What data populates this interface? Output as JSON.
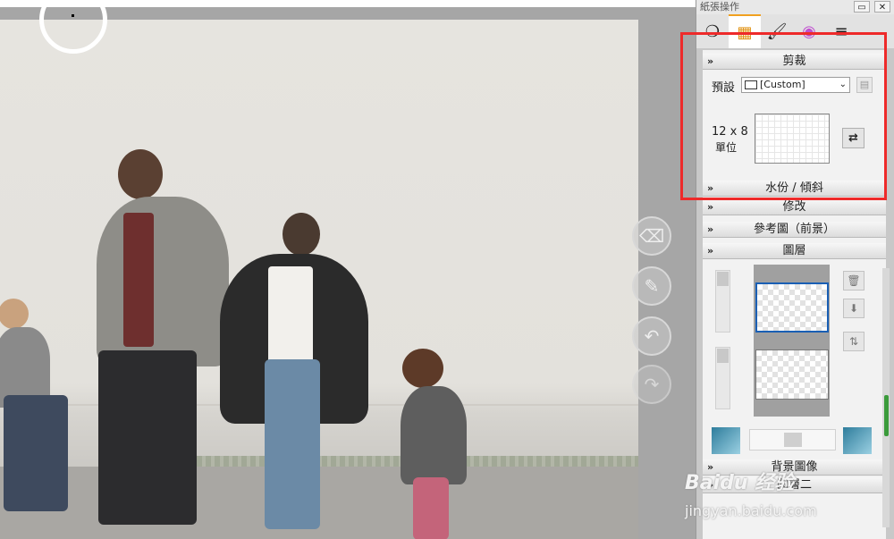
{
  "panel": {
    "title": "紙張操作",
    "minimize_label": "▭",
    "close_label": "✕",
    "tabs": [
      {
        "icon": "paper-icon",
        "glyph": "❍"
      },
      {
        "icon": "canvas-settings-icon",
        "glyph": "▦"
      },
      {
        "icon": "brush-icon",
        "glyph": "🖌"
      },
      {
        "icon": "color-wheel-icon",
        "glyph": "◉"
      },
      {
        "icon": "layers-list-icon",
        "glyph": "≡"
      }
    ]
  },
  "crop": {
    "header": "剪裁",
    "preset_label": "預設",
    "preset_value": "[Custom]",
    "size_text": "12 x 8",
    "unit_text": "單位"
  },
  "sections": {
    "watermark_tilt": "水份 / 傾斜",
    "modify": "修改",
    "reference": "參考圖（前景）",
    "layers": "圖層",
    "background_image": "背景圖像",
    "bottom_partial": "圖層二"
  },
  "watermark_text": {
    "brand": "Baidu 经验",
    "url": "jingyan.baidu.com"
  },
  "colors": {
    "highlight_box": "#ee2a2a",
    "selected_layer": "#1a5fb4",
    "scroll_thumb": "#3b9b3b"
  }
}
